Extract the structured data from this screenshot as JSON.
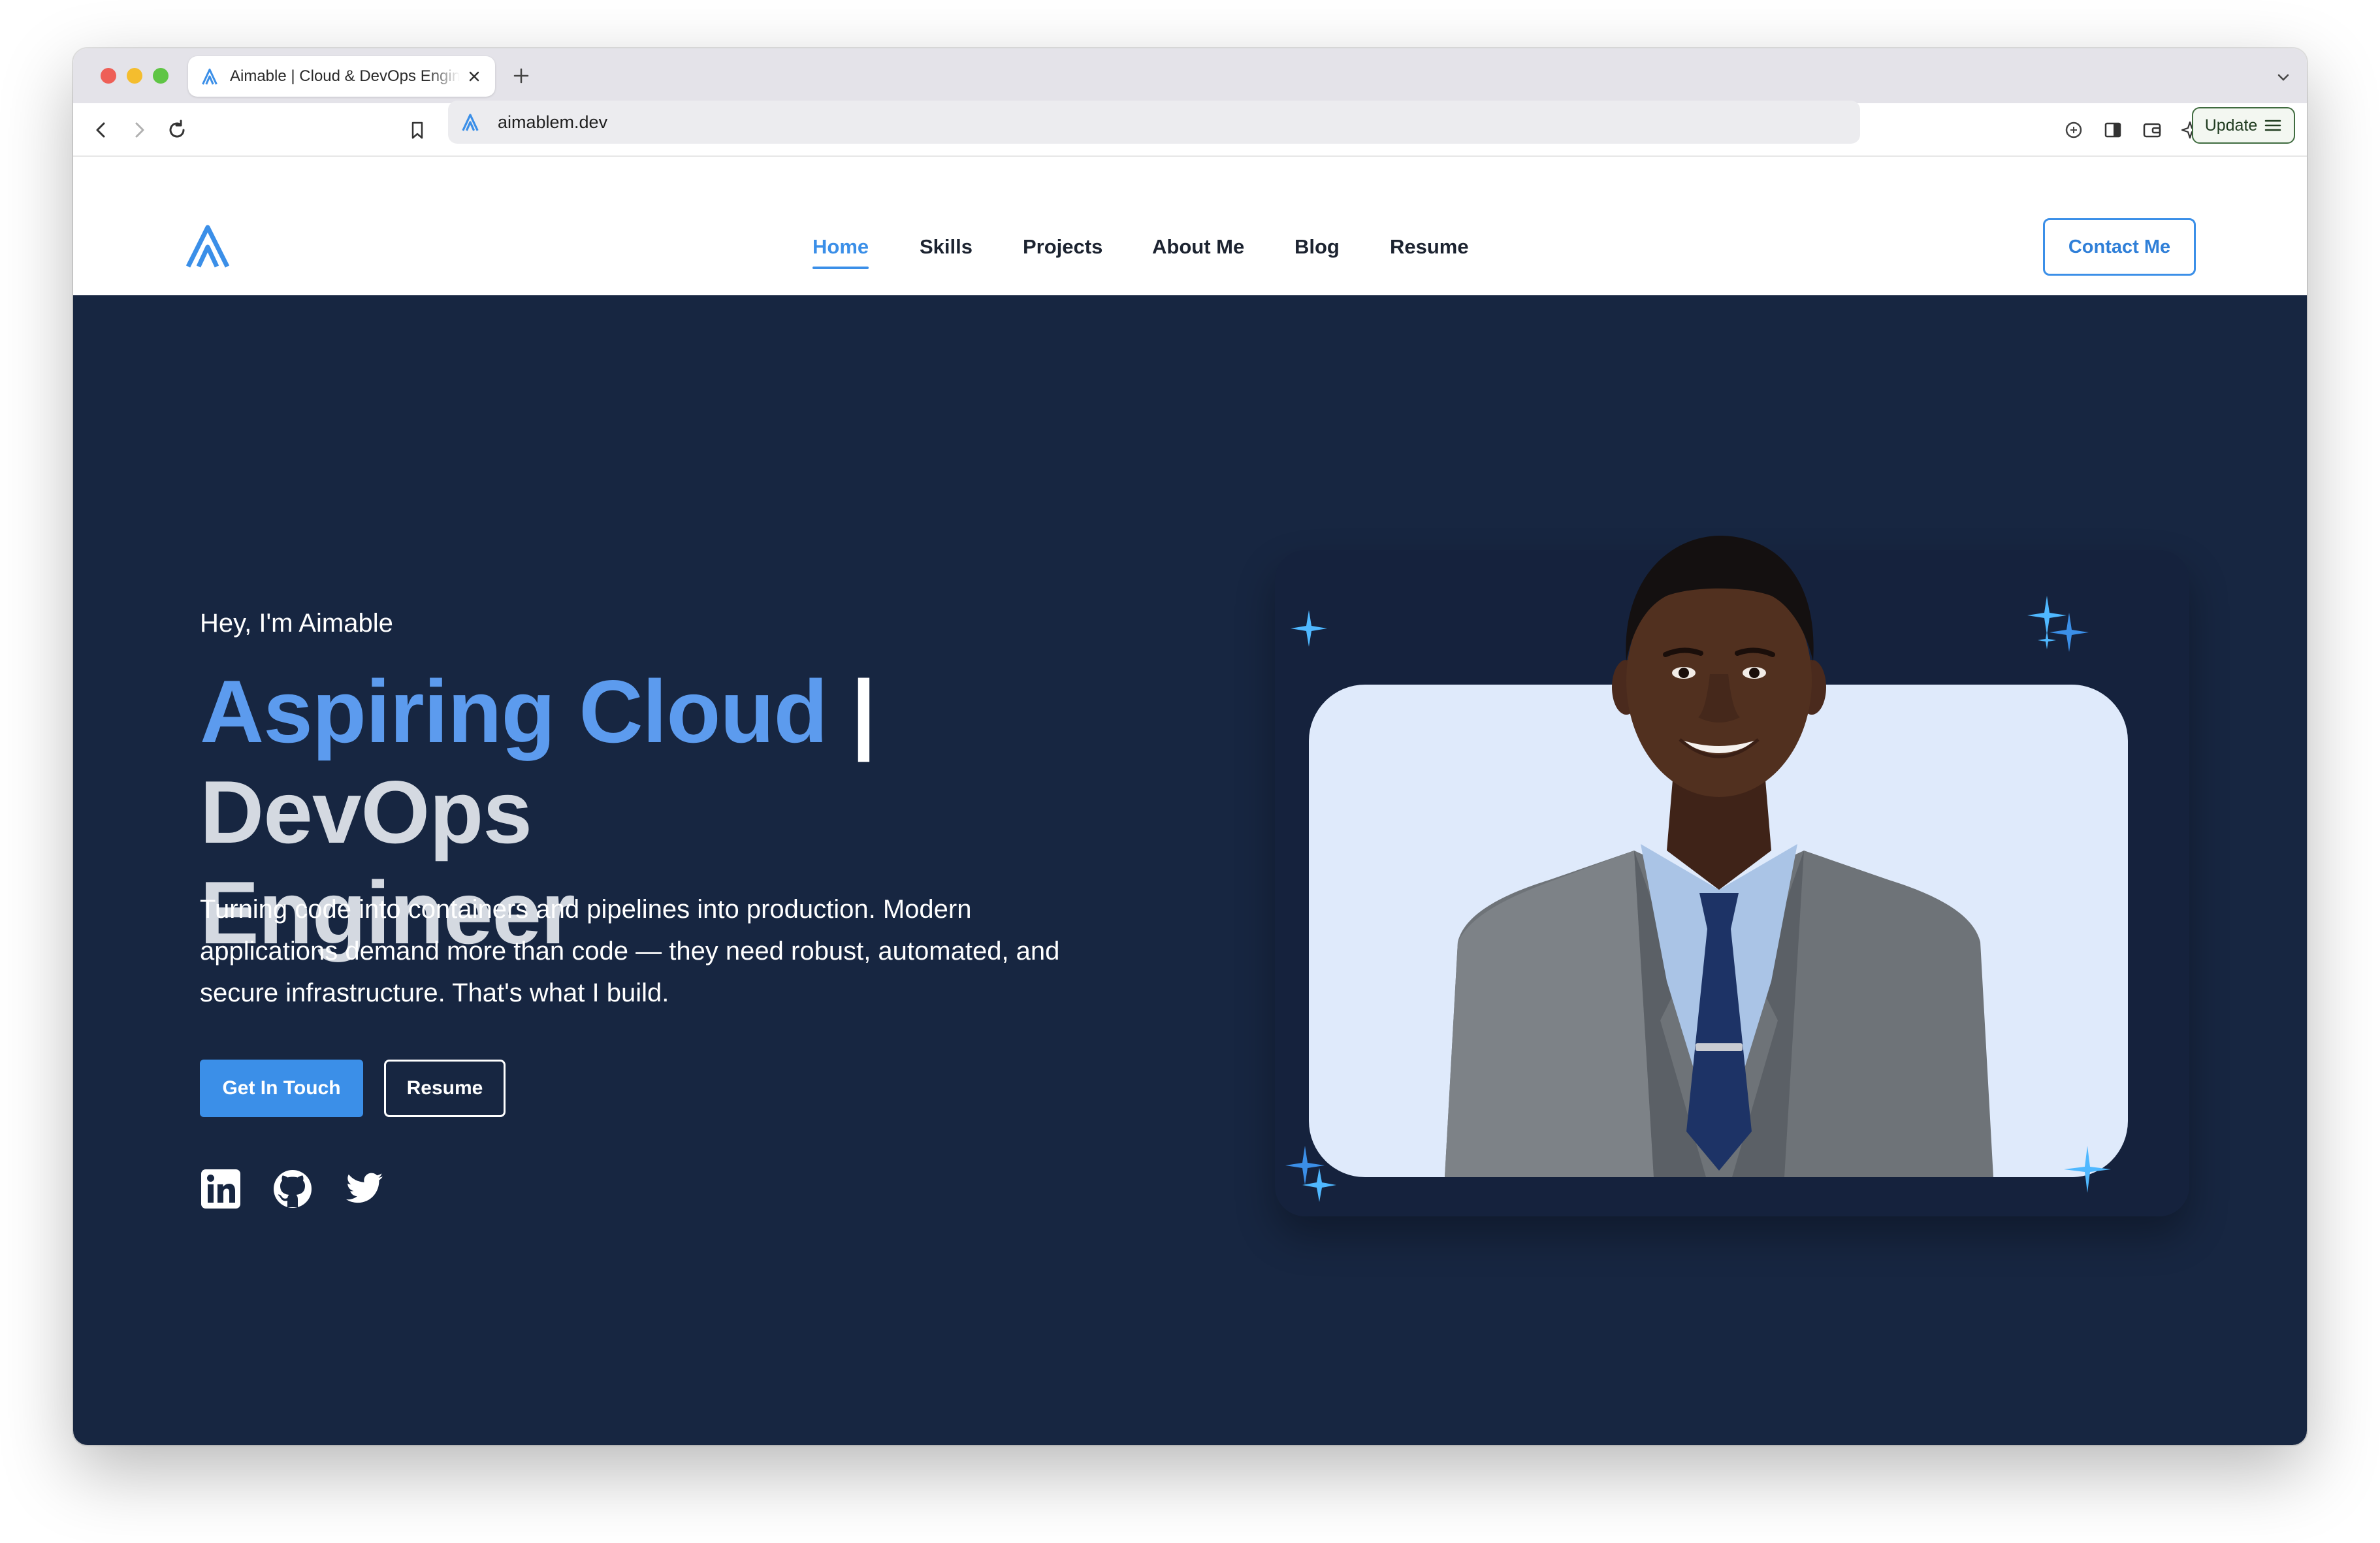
{
  "browser": {
    "tab_title": "Aimable | Cloud & DevOps Engineer",
    "url": "aimablem.dev",
    "update_label": "Update"
  },
  "site": {
    "nav": [
      {
        "label": "Home",
        "active": true
      },
      {
        "label": "Skills",
        "active": false
      },
      {
        "label": "Projects",
        "active": false
      },
      {
        "label": "About Me",
        "active": false
      },
      {
        "label": "Blog",
        "active": false
      },
      {
        "label": "Resume",
        "active": false
      }
    ],
    "contact_label": "Contact Me"
  },
  "hero": {
    "greeting": "Hey, I'm Aimable",
    "headline_accent": "Aspiring Cloud",
    "headline_separator": "|",
    "headline_rest_1": "DevOps",
    "headline_rest_2": "Engineer",
    "intro": "Turning code into containers and pipelines into production. Modern applications demand more than code — they need robust, automated, and secure infrastructure. That's what I build.",
    "primary_button": "Get In Touch",
    "secondary_button": "Resume",
    "social": [
      "linkedin-icon",
      "github-icon",
      "twitter-icon"
    ]
  },
  "colors": {
    "hero_bg": "#172641",
    "accent": "#3b8fe8",
    "headline_accent": "#5c9bee",
    "card_bg": "#dfeafb"
  }
}
